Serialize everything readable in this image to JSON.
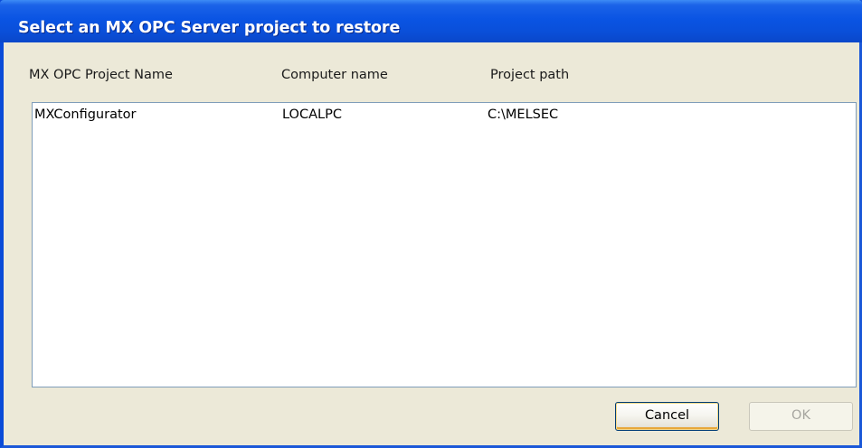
{
  "dialog": {
    "title": "Select an MX OPC Server project to restore"
  },
  "columns": [
    {
      "label": "MX OPC Project Name"
    },
    {
      "label": "Computer name"
    },
    {
      "label": "Project path"
    }
  ],
  "rows": [
    {
      "project_name": "MXConfigurator",
      "computer_name": "LOCALPC",
      "project_path": "C:\\MELSEC"
    }
  ],
  "buttons": {
    "cancel_label": "Cancel",
    "ok_label": "OK",
    "ok_enabled": false
  },
  "colors": {
    "titlebar_blue": "#0a54e3",
    "dialog_bg": "#ece9d8",
    "list_border": "#7f9db9",
    "disabled_text": "#a7a6a0"
  }
}
